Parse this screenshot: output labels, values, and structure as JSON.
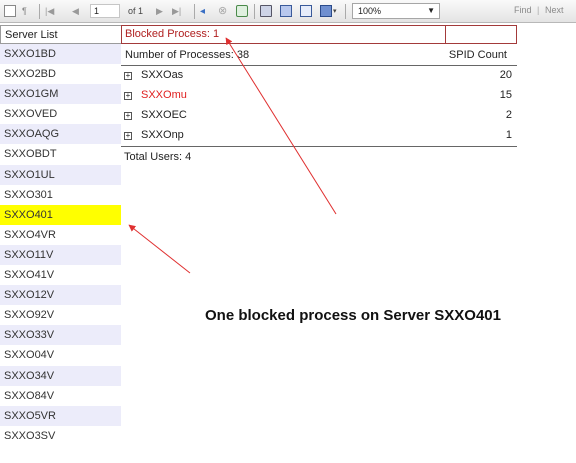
{
  "toolbar": {
    "page_current": "1",
    "page_of": "of 1",
    "zoom": "100%",
    "find_label": "Find",
    "separator": "|",
    "next_label": "Next"
  },
  "sidebar": {
    "header": "Server List",
    "servers": [
      "SXXO1BD",
      "SXXO2BD",
      "SXXO1GM",
      "SXXOVED",
      "SXXOAQG",
      "SXXOBDT",
      "SXXO1UL",
      "SXXO301",
      "SXXO401",
      "SXXO4VR",
      "SXXO11V",
      "SXXO41V",
      "SXXO12V",
      "SXXO92V",
      "SXXO33V",
      "SXXO04V",
      "SXXO34V",
      "SXXO84V",
      "SXXO5VR",
      "SXXO3SV"
    ],
    "selected": "SXXO401"
  },
  "panel": {
    "title": "Blocked Process: 1",
    "process_count_label": "Number of Processes: 38",
    "spid_header": "SPID Count",
    "processes": [
      {
        "name": "SXXOas",
        "count": "20",
        "highlight": false
      },
      {
        "name": "SXXOmu",
        "count": "15",
        "highlight": true
      },
      {
        "name": "SXXOEC",
        "count": "2",
        "highlight": false
      },
      {
        "name": "SXXOnp",
        "count": "1",
        "highlight": false
      }
    ],
    "total_users": "Total Users: 4"
  },
  "annotation": {
    "text": "One blocked process on Server SXXO401",
    "arrow_color": "#e03030"
  },
  "colors": {
    "selected_row": "#ffff00",
    "alt_row": "#ececfa",
    "title_red": "#b02020",
    "highlight_red": "#e02020"
  }
}
